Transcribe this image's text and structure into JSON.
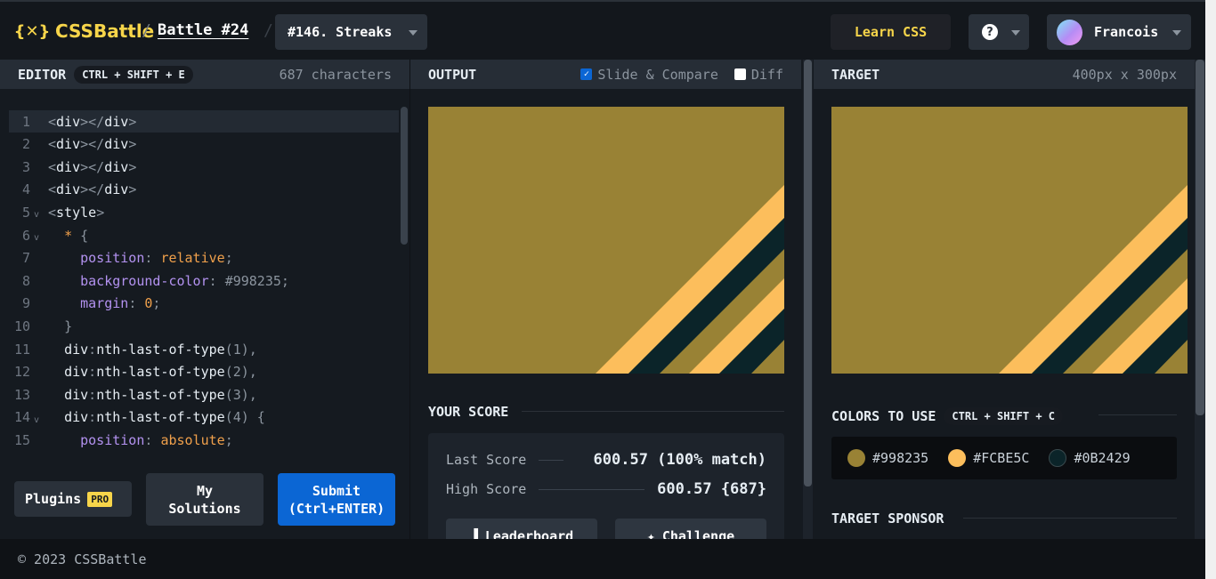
{
  "header": {
    "logo_text": "CSSBattle",
    "logo_mark": "{✕}",
    "battle_label": "Battle #24",
    "target_select": "#146. Streaks",
    "learn_button": "Learn CSS",
    "help_icon": "?",
    "user_name": "Francois"
  },
  "editor": {
    "title": "EDITOR",
    "shortcut": "CTRL + SHIFT + E",
    "char_count": "687 characters",
    "lines": [
      {
        "n": "1",
        "fold": "",
        "tokens": [
          [
            "t-br",
            "<"
          ],
          [
            "t-tag",
            "div"
          ],
          [
            "t-br",
            "></"
          ],
          [
            "t-tag",
            "div"
          ],
          [
            "t-br",
            ">"
          ]
        ]
      },
      {
        "n": "2",
        "fold": "",
        "tokens": [
          [
            "t-br",
            "<"
          ],
          [
            "t-tag",
            "div"
          ],
          [
            "t-br",
            "></"
          ],
          [
            "t-tag",
            "div"
          ],
          [
            "t-br",
            ">"
          ]
        ]
      },
      {
        "n": "3",
        "fold": "",
        "tokens": [
          [
            "t-br",
            "<"
          ],
          [
            "t-tag",
            "div"
          ],
          [
            "t-br",
            "></"
          ],
          [
            "t-tag",
            "div"
          ],
          [
            "t-br",
            ">"
          ]
        ]
      },
      {
        "n": "4",
        "fold": "",
        "tokens": [
          [
            "t-br",
            "<"
          ],
          [
            "t-tag",
            "div"
          ],
          [
            "t-br",
            "></"
          ],
          [
            "t-tag",
            "div"
          ],
          [
            "t-br",
            ">"
          ]
        ]
      },
      {
        "n": "5",
        "fold": "v",
        "tokens": [
          [
            "t-br",
            "<"
          ],
          [
            "t-tag",
            "style"
          ],
          [
            "t-br",
            ">"
          ]
        ]
      },
      {
        "n": "6",
        "fold": "v",
        "tokens": [
          [
            "t-tag",
            "  "
          ],
          [
            "t-star",
            "*"
          ],
          [
            "t-br",
            " {"
          ]
        ]
      },
      {
        "n": "7",
        "fold": "",
        "tokens": [
          [
            "t-tag",
            "    "
          ],
          [
            "t-prop",
            "position"
          ],
          [
            "t-br",
            ": "
          ],
          [
            "t-val",
            "relative"
          ],
          [
            "t-br",
            ";"
          ]
        ]
      },
      {
        "n": "8",
        "fold": "",
        "tokens": [
          [
            "t-tag",
            "    "
          ],
          [
            "t-prop",
            "background-color"
          ],
          [
            "t-br",
            ": "
          ],
          [
            "t-hex",
            "#998235"
          ],
          [
            "t-br",
            ";"
          ]
        ]
      },
      {
        "n": "9",
        "fold": "",
        "tokens": [
          [
            "t-tag",
            "    "
          ],
          [
            "t-prop",
            "margin"
          ],
          [
            "t-br",
            ": "
          ],
          [
            "t-num",
            "0"
          ],
          [
            "t-br",
            ";"
          ]
        ]
      },
      {
        "n": "10",
        "fold": "",
        "tokens": [
          [
            "t-tag",
            "  "
          ],
          [
            "t-br",
            "}"
          ]
        ]
      },
      {
        "n": "11",
        "fold": "",
        "tokens": [
          [
            "t-tag",
            "  "
          ],
          [
            "t-sel",
            "div"
          ],
          [
            "t-br",
            ":"
          ],
          [
            "t-sel",
            "nth-last-of-type"
          ],
          [
            "t-fn",
            "(1)"
          ],
          [
            "t-br",
            ","
          ]
        ]
      },
      {
        "n": "12",
        "fold": "",
        "tokens": [
          [
            "t-tag",
            "  "
          ],
          [
            "t-sel",
            "div"
          ],
          [
            "t-br",
            ":"
          ],
          [
            "t-sel",
            "nth-last-of-type"
          ],
          [
            "t-fn",
            "(2)"
          ],
          [
            "t-br",
            ","
          ]
        ]
      },
      {
        "n": "13",
        "fold": "",
        "tokens": [
          [
            "t-tag",
            "  "
          ],
          [
            "t-sel",
            "div"
          ],
          [
            "t-br",
            ":"
          ],
          [
            "t-sel",
            "nth-last-of-type"
          ],
          [
            "t-fn",
            "(3)"
          ],
          [
            "t-br",
            ","
          ]
        ]
      },
      {
        "n": "14",
        "fold": "v",
        "tokens": [
          [
            "t-tag",
            "  "
          ],
          [
            "t-sel",
            "div"
          ],
          [
            "t-br",
            ":"
          ],
          [
            "t-sel",
            "nth-last-of-type"
          ],
          [
            "t-fn",
            "(4)"
          ],
          [
            "t-br",
            " {"
          ]
        ]
      },
      {
        "n": "15",
        "fold": "",
        "tokens": [
          [
            "t-tag",
            "    "
          ],
          [
            "t-prop",
            "position"
          ],
          [
            "t-br",
            ": "
          ],
          [
            "t-val",
            "absolute"
          ],
          [
            "t-br",
            ";"
          ]
        ]
      }
    ],
    "plugins_label": "Plugins",
    "pro_badge": "PRO",
    "solutions_label": "My\nSolutions",
    "submit_label": "Submit\n(Ctrl+ENTER)"
  },
  "output": {
    "title": "OUTPUT",
    "slide_compare_label": "Slide & Compare",
    "slide_compare_checked": true,
    "diff_label": "Diff",
    "diff_checked": false,
    "score_title": "YOUR SCORE",
    "last_score_label": "Last Score",
    "last_score_value": "600.57 (100% match)",
    "high_score_label": "High Score",
    "high_score_value": "600.57 {687}",
    "leaderboard_label": "Leaderboard",
    "challenge_label": "Challenge"
  },
  "target": {
    "title": "TARGET",
    "dimensions": "400px x 300px",
    "colors_title": "COLORS TO USE",
    "colors_shortcut": "CTRL + SHIFT + C",
    "colors": [
      "#998235",
      "#FCBE5C",
      "#0B2429"
    ],
    "sponsor_title": "TARGET SPONSOR"
  },
  "footer": {
    "copyright": "© 2023 CSSBattle"
  }
}
